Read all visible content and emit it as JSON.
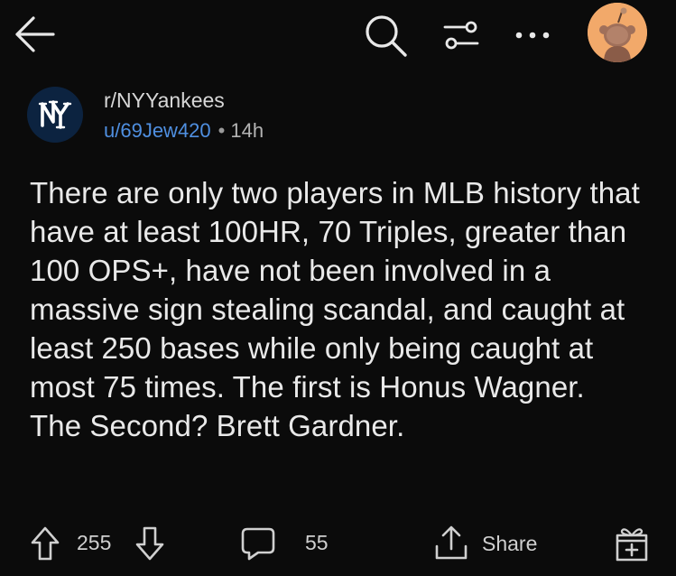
{
  "topbar": {
    "icons": [
      "back-arrow-icon",
      "search-icon",
      "filter-icon",
      "more-icon",
      "user-avatar"
    ]
  },
  "post": {
    "subreddit": "r/NYYankees",
    "author": "u/69Jew420",
    "separator": "•",
    "age": "14h",
    "body": "There are only two players in MLB history that have at least 100HR, 70 Triples, greater than 100 OPS+, have not been involved in a massive sign stealing scandal, and caught at least 250 bases while only being caught at most 75 times. The first is Honus Wagner. The Second? Brett Gardner."
  },
  "actions": {
    "vote_count": "255",
    "comment_count": "55",
    "share_label": "Share"
  },
  "colors": {
    "background": "#0b0b0b",
    "username": "#4f8fe0",
    "avatar_bg": "#f2a96a",
    "subreddit_avatar_bg": "#0c2340"
  }
}
